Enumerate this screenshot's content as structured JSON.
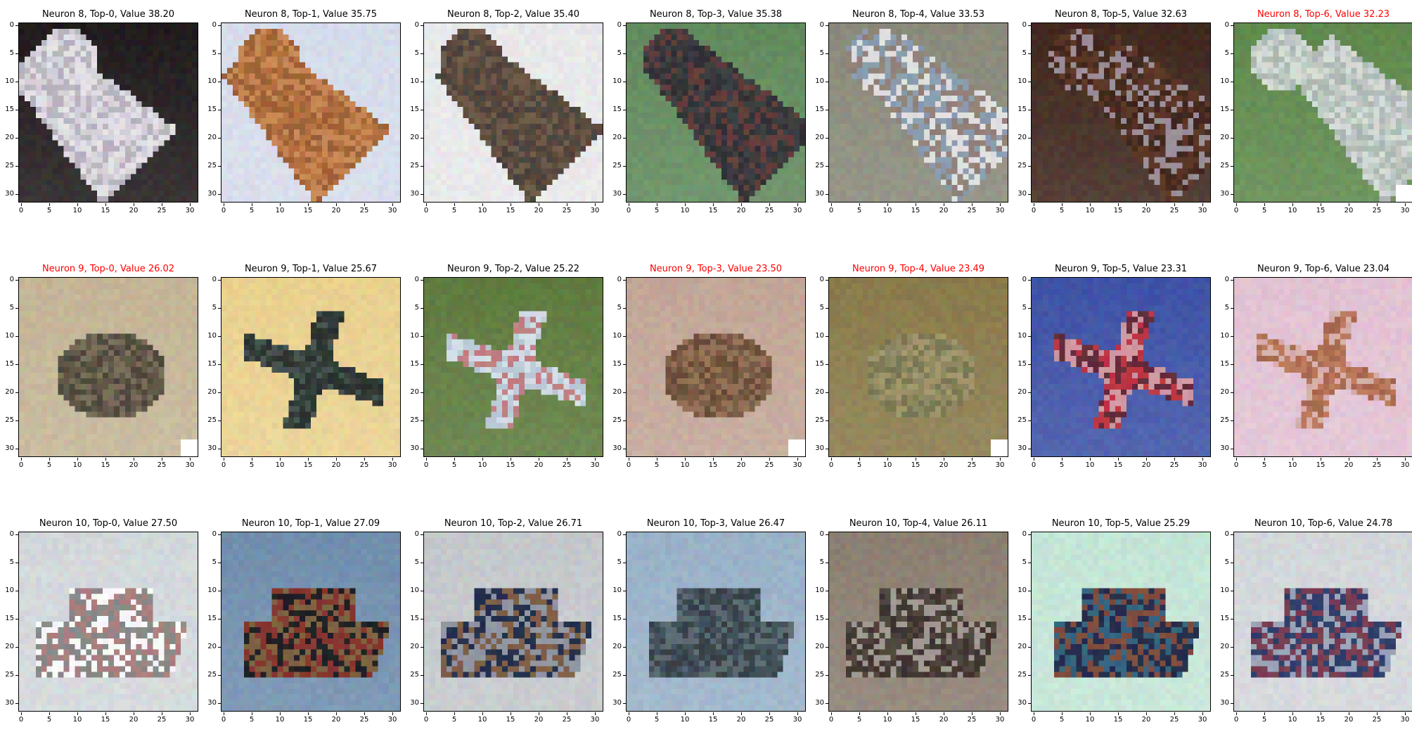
{
  "tick_labels": [
    "0",
    "5",
    "10",
    "15",
    "20",
    "25",
    "30"
  ],
  "title_colors": {
    "normal": "#000000",
    "highlight": "#ff0000"
  },
  "rows": [
    {
      "panels": [
        {
          "title": "Neuron 8, Top-0, Value 38.20",
          "highlight": false,
          "image": {
            "subject": "white horse head",
            "bg": "#1a1416",
            "colors": [
              "#e9e6ec",
              "#cfcbd6",
              "#9d97a6"
            ],
            "patch": false
          }
        },
        {
          "title": "Neuron 8, Top-1, Value 35.75",
          "highlight": false,
          "image": {
            "subject": "brown horse head",
            "bg": "#dbe2f2",
            "colors": [
              "#b8703c",
              "#8f5429",
              "#d99a63"
            ],
            "patch": false
          }
        },
        {
          "title": "Neuron 8, Top-2, Value 35.40",
          "highlight": false,
          "image": {
            "subject": "dark horse head",
            "bg": "#efeff1",
            "colors": [
              "#5a4638",
              "#3a3a3c",
              "#7a6450"
            ],
            "patch": false
          }
        },
        {
          "title": "Neuron 8, Top-3, Value 35.38",
          "highlight": false,
          "image": {
            "subject": "black horse near fence",
            "bg": "#5f8a5a",
            "colors": [
              "#3a3a3e",
              "#25252a",
              "#7c3a33"
            ],
            "patch": false
          }
        },
        {
          "title": "Neuron 8, Top-4, Value 33.53",
          "highlight": false,
          "image": {
            "subject": "rider on pinto horse",
            "bg": "#8a8a7a",
            "colors": [
              "#e6e6e6",
              "#5b4030",
              "#4f6e8f"
            ],
            "patch": false
          }
        },
        {
          "title": "Neuron 8, Top-5, Value 32.63",
          "highlight": false,
          "image": {
            "subject": "dark brown horse close-up",
            "bg": "#3b2218",
            "colors": [
              "#5a3222",
              "#2a1710",
              "#c9cdea"
            ],
            "patch": false
          }
        },
        {
          "title": "Neuron 8, Top-6, Value 32.23",
          "highlight": true,
          "image": {
            "subject": "grey horse head",
            "bg": "#5d8a4a",
            "colors": [
              "#c3cec8",
              "#a3b1ad",
              "#e8ede9"
            ],
            "patch": true
          }
        }
      ]
    },
    {
      "panels": [
        {
          "title": "Neuron 9, Top-0, Value 26.02",
          "highlight": true,
          "image": {
            "subject": "frog on sand",
            "bg": "#c8b897",
            "colors": [
              "#5f5646",
              "#8a7c62",
              "#3d382e"
            ],
            "patch": true
          }
        },
        {
          "title": "Neuron 9, Top-1, Value 25.67",
          "highlight": false,
          "image": {
            "subject": "stealth bomber",
            "bg": "#f0d68f",
            "colors": [
              "#2f3a36",
              "#50605a",
              "#1e2623"
            ],
            "patch": false
          }
        },
        {
          "title": "Neuron 9, Top-2, Value 25.22",
          "highlight": false,
          "image": {
            "subject": "jet on grass",
            "bg": "#5c7a3a",
            "colors": [
              "#d8e4ee",
              "#aebfd0",
              "#b83a3a"
            ],
            "patch": false
          }
        },
        {
          "title": "Neuron 9, Top-3, Value 23.50",
          "highlight": true,
          "image": {
            "subject": "frog on gravel",
            "bg": "#c6a898",
            "colors": [
              "#7a5a42",
              "#5c3e2c",
              "#a88060"
            ],
            "patch": true
          }
        },
        {
          "title": "Neuron 9, Top-4, Value 23.49",
          "highlight": true,
          "image": {
            "subject": "frog in leaves",
            "bg": "#8a7a48",
            "colors": [
              "#8f8a60",
              "#6a6a45",
              "#b0a070"
            ],
            "patch": true
          }
        },
        {
          "title": "Neuron 9, Top-5, Value 23.31",
          "highlight": false,
          "image": {
            "subject": "red biplane",
            "bg": "#3a4fa8",
            "colors": [
              "#c23040",
              "#e0e0e8",
              "#202030"
            ],
            "patch": false
          }
        },
        {
          "title": "Neuron 9, Top-6, Value 23.04",
          "highlight": false,
          "image": {
            "subject": "fighter jet in pink sky",
            "bg": "#e8c6d8",
            "colors": [
              "#c07a5a",
              "#9a5a42",
              "#f0d8e4"
            ],
            "patch": false
          }
        }
      ]
    },
    {
      "panels": [
        {
          "title": "Neuron 10, Top-0, Value 27.50",
          "highlight": false,
          "image": {
            "subject": "ferry boat",
            "bg": "#d8dde0",
            "colors": [
              "#ffffff",
              "#7a2a2a",
              "#3a3a3a"
            ],
            "patch": false
          }
        },
        {
          "title": "Neuron 10, Top-1, Value 27.09",
          "highlight": false,
          "image": {
            "subject": "cargo ship bow",
            "bg": "#6f8fb0",
            "colors": [
              "#1a1a20",
              "#d04030",
              "#c09050"
            ],
            "patch": false
          }
        },
        {
          "title": "Neuron 10, Top-2, Value 26.71",
          "highlight": false,
          "image": {
            "subject": "container ship",
            "bg": "#c8ccd0",
            "colors": [
              "#1e2a4a",
              "#c08040",
              "#e0e0e0"
            ],
            "patch": false
          }
        },
        {
          "title": "Neuron 10, Top-3, Value 26.47",
          "highlight": false,
          "image": {
            "subject": "cruise ship at dock",
            "bg": "#9ab4cc",
            "colors": [
              "#40505a",
              "#6a7a80",
              "#2a3036"
            ],
            "patch": false
          }
        },
        {
          "title": "Neuron 10, Top-4, Value 26.11",
          "highlight": false,
          "image": {
            "subject": "old photo of boat",
            "bg": "#8c7e70",
            "colors": [
              "#3a302a",
              "#e8e2da",
              "#5a4e44"
            ],
            "patch": false
          }
        },
        {
          "title": "Neuron 10, Top-5, Value 25.29",
          "highlight": false,
          "image": {
            "subject": "ship with red hull",
            "bg": "#c8ecdc",
            "colors": [
              "#20284a",
              "#3a8aa0",
              "#c06030"
            ],
            "patch": false
          }
        },
        {
          "title": "Neuron 10, Top-6, Value 24.78",
          "highlight": false,
          "image": {
            "subject": "white passenger ship",
            "bg": "#d8dce0",
            "colors": [
              "#2a3a6a",
              "#e8eef4",
              "#b03a40"
            ],
            "patch": false
          }
        }
      ]
    }
  ]
}
